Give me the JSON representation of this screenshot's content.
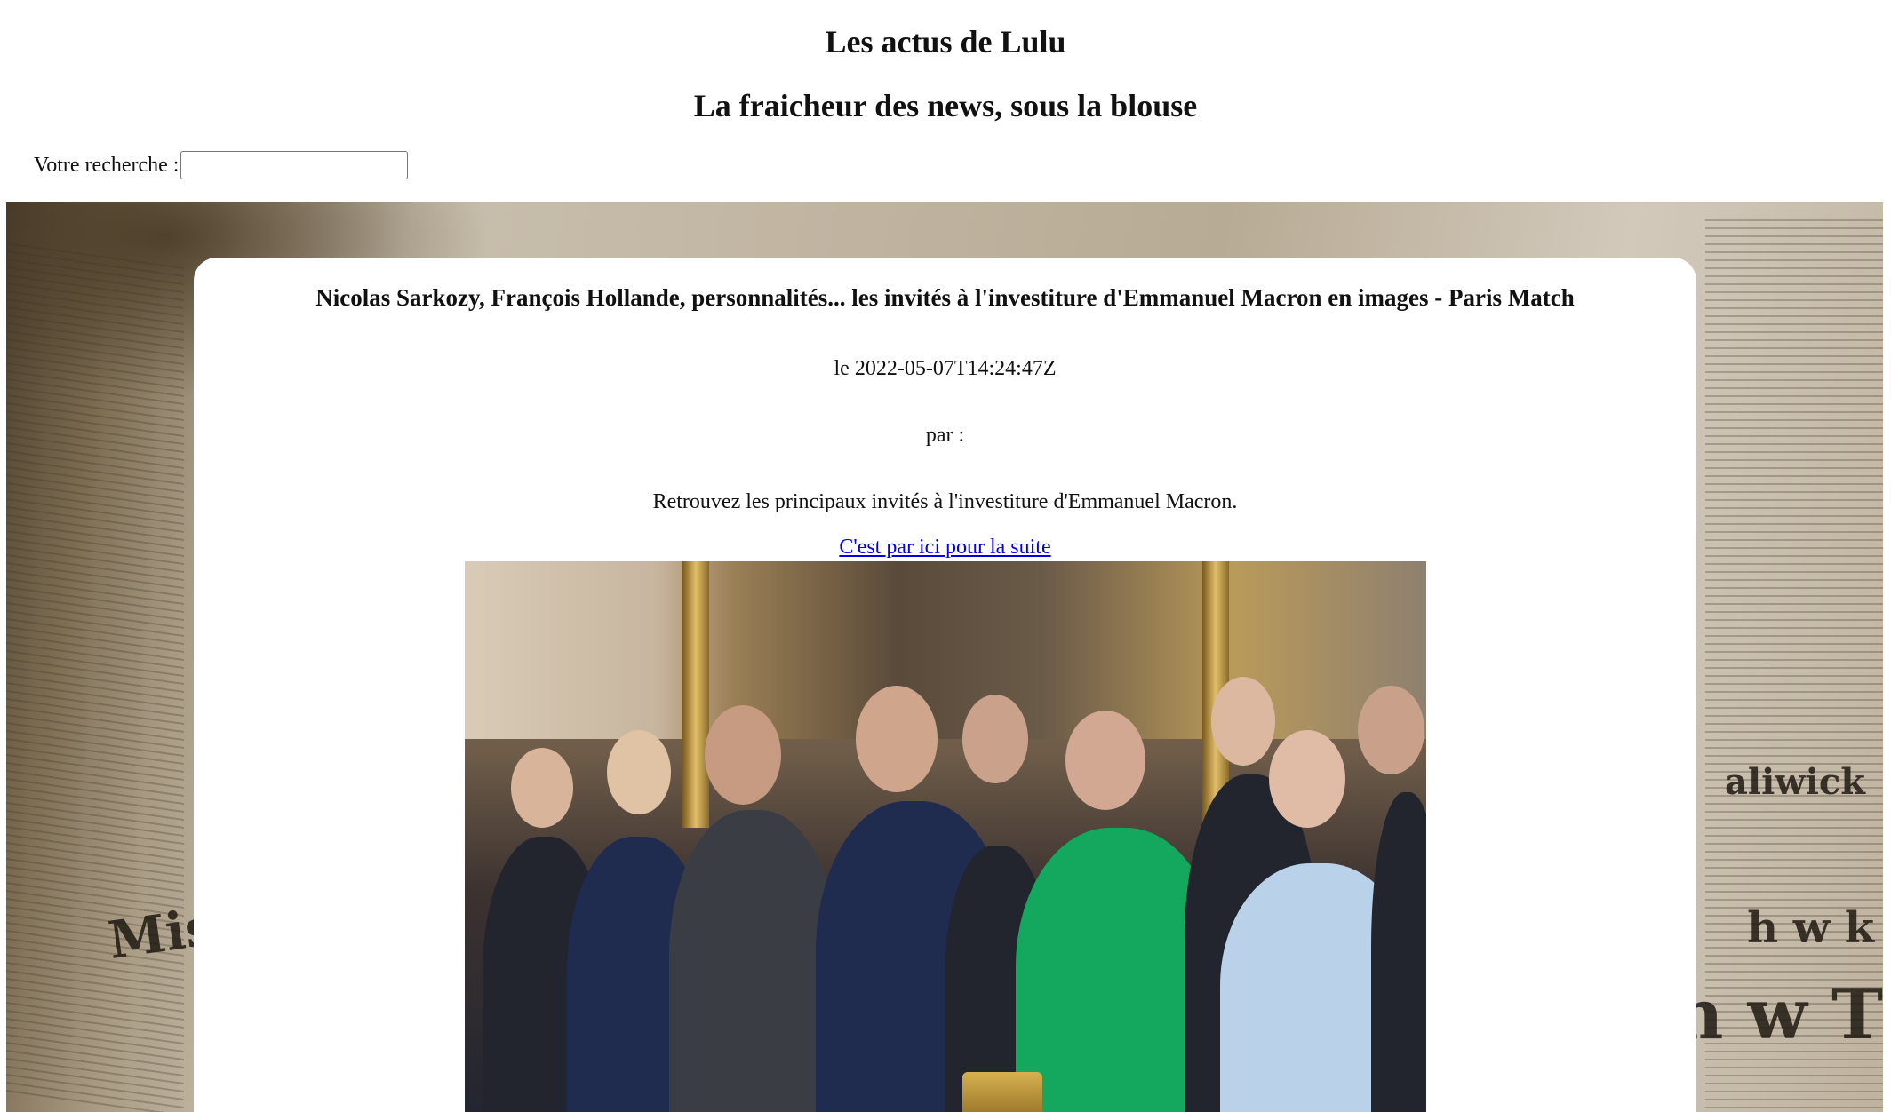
{
  "site": {
    "title": "Les actus de Lulu",
    "subtitle": "La fraicheur des news, sous la blouse"
  },
  "search": {
    "label": "Votre recherche :",
    "value": ""
  },
  "article": {
    "title": "Nicolas Sarkozy, François Hollande, personnalités... les invités à l'investiture d'Emmanuel Macron en images - Paris Match",
    "date": "le 2022-05-07T14:24:47Z",
    "author": "par :",
    "description": "Retrouvez les principaux invités à l'investiture d'Emmanuel Macron.",
    "link_label": "C'est par ici pour la suite"
  },
  "colors": {
    "link": "#0000ee",
    "card_background": "#ffffff"
  }
}
